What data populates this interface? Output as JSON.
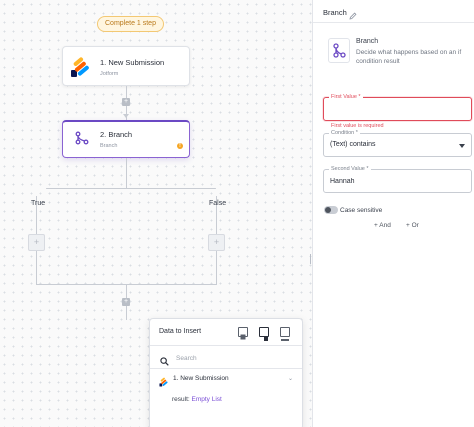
{
  "canvas": {
    "status_pill": "Complete 1 step",
    "nodes": [
      {
        "title": "1. New Submission",
        "subtitle": "Jotform"
      },
      {
        "title": "2. Branch",
        "subtitle": "Branch",
        "warning": "!"
      }
    ],
    "branches": {
      "true_label": "True",
      "false_label": "False"
    },
    "add_step_symbol": "+"
  },
  "data_to_insert": {
    "title": "Data to Insert",
    "search_placeholder": "Search",
    "source": {
      "label": "1. New Submission",
      "chevron": "⌄"
    },
    "result_key": "result:",
    "result_value": "Empty List"
  },
  "panel": {
    "title": "Branch",
    "info": {
      "title": "Branch",
      "description": "Decide what happens based on an if condition result"
    },
    "first_value": {
      "label": "First Value *",
      "value": "",
      "error": "First value is required"
    },
    "condition": {
      "label": "Condition *",
      "value": "(Text) contains"
    },
    "second_value": {
      "label": "Second Value *",
      "value": "Hannah"
    },
    "case_sensitive_label": "Case sensitive",
    "add_and_label": "+ And",
    "add_or_label": "+ Or"
  },
  "colors": {
    "accent": "#6b49c4",
    "error": "#e04b5a",
    "pill_bg": "#fff6e0",
    "link": "#7a4ed6"
  }
}
